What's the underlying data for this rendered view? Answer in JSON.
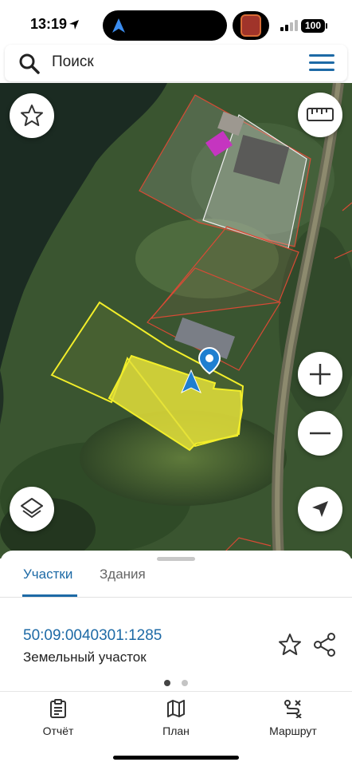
{
  "status_bar": {
    "time": "13:19",
    "battery": "100"
  },
  "search": {
    "placeholder": "Поиск",
    "icon": "search-icon",
    "menu_icon": "hamburger-menu-icon"
  },
  "map": {
    "buttons": {
      "favorite": "star-icon",
      "ruler": "ruler-icon",
      "zoom_in": "plus-icon",
      "zoom_out": "minus-icon",
      "layers": "layers-icon",
      "locate": "navigation-arrow-icon"
    },
    "colors": {
      "selected_parcel_fill": "#e4e13a",
      "selected_parcel_border": "#f2ee2a",
      "parcel_border": "#e0503a",
      "location_marker": "#1f7fd0"
    }
  },
  "sheet": {
    "tabs": [
      {
        "label": "Участки",
        "active": true
      },
      {
        "label": "Здания",
        "active": false
      }
    ],
    "parcel": {
      "cadastral_number": "50:09:0040301:1285",
      "type": "Земельный участок"
    },
    "pager": {
      "current": 1,
      "total": 2
    }
  },
  "bottom_nav": [
    {
      "label": "Отчёт",
      "icon": "report-clipboard-icon"
    },
    {
      "label": "План",
      "icon": "map-plan-icon"
    },
    {
      "label": "Маршрут",
      "icon": "route-icon"
    }
  ],
  "accent_color": "#1d6aa6"
}
